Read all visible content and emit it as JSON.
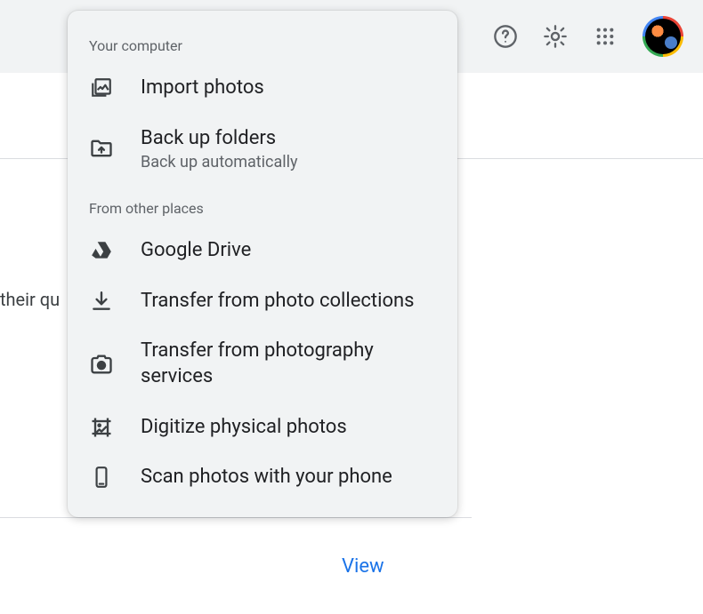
{
  "menu": {
    "section1_label": "Your computer",
    "section2_label": "From other places",
    "import_photos": "Import photos",
    "backup_folders": "Back up folders",
    "backup_folders_sub": "Back up automatically",
    "google_drive": "Google Drive",
    "transfer_collections": "Transfer from photo collections",
    "transfer_services": "Transfer from photography services",
    "digitize": "Digitize physical photos",
    "scan_phone": "Scan photos with your phone"
  },
  "page": {
    "bg_text_fragment": "their qu",
    "view_link": "View"
  }
}
